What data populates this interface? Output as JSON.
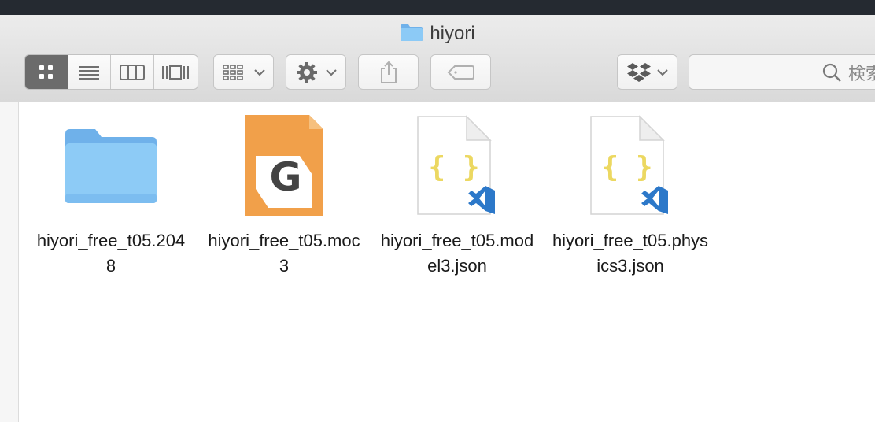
{
  "window": {
    "title": "hiyori"
  },
  "toolbar": {
    "view_modes": [
      "icon-view",
      "list-view",
      "column-view",
      "cover-flow-view"
    ],
    "active_view": "icon-view",
    "search_placeholder": "検索"
  },
  "files": [
    {
      "name": "hiyori_free_t05.2048",
      "icon": "folder-icon"
    },
    {
      "name": "hiyori_free_t05.moc3",
      "icon": "moc3-file-icon"
    },
    {
      "name": "hiyori_free_t05.model3.json",
      "icon": "json-file-icon"
    },
    {
      "name": "hiyori_free_t05.physics3.json",
      "icon": "json-file-icon"
    }
  ],
  "colors": {
    "folder_blue": "#7fbff2",
    "moc_orange": "#f1a04a",
    "json_brace_yellow": "#ecd861",
    "vscode_blue": "#2c78c9"
  }
}
